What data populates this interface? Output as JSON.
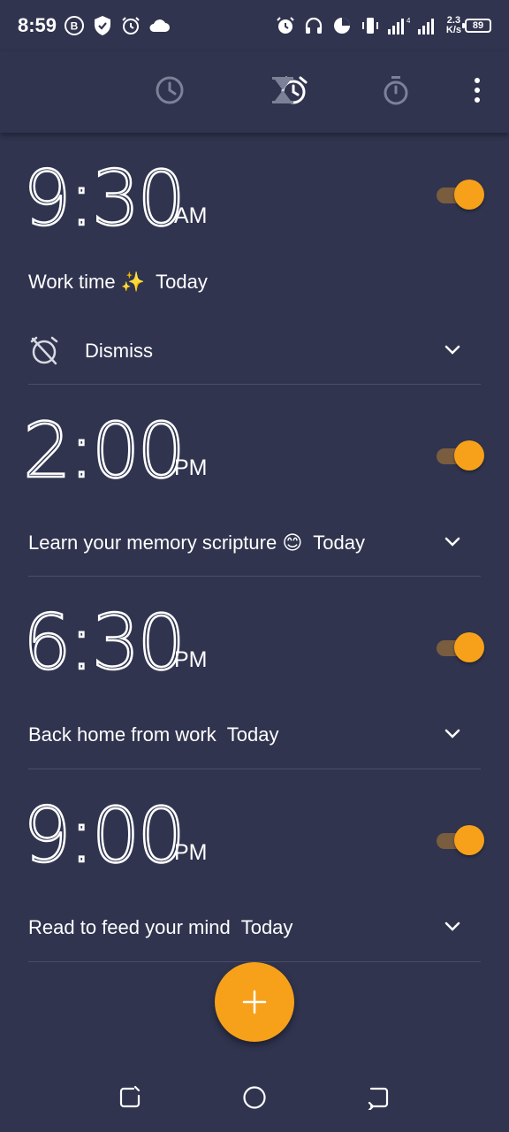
{
  "status_bar": {
    "time": "8:59",
    "net_speed_value": "2.3",
    "net_speed_unit": "K/s",
    "network_type": "4G",
    "battery": "89"
  },
  "tabs": [
    {
      "icon": "alarm-icon",
      "active": true
    },
    {
      "icon": "clock-icon",
      "active": false
    },
    {
      "icon": "hourglass-icon",
      "active": false
    },
    {
      "icon": "stopwatch-icon",
      "active": false
    }
  ],
  "alarms": [
    {
      "time": "9:30",
      "ampm": "AM",
      "label": "Work time ✨",
      "when": "Today",
      "enabled": true,
      "dismiss_label": "Dismiss"
    },
    {
      "time": "2:00",
      "ampm": "PM",
      "label": "Learn your memory scripture 😊",
      "when": "Today",
      "enabled": true
    },
    {
      "time": "6:30",
      "ampm": "PM",
      "label": "Back home from work",
      "when": "Today",
      "enabled": true
    },
    {
      "time": "9:00",
      "ampm": "PM",
      "label": "Read to feed your mind",
      "when": "Today",
      "enabled": true
    }
  ],
  "colors": {
    "background": "#30344f",
    "accent": "#f7a11a",
    "inactive_icon": "#7c8197"
  }
}
